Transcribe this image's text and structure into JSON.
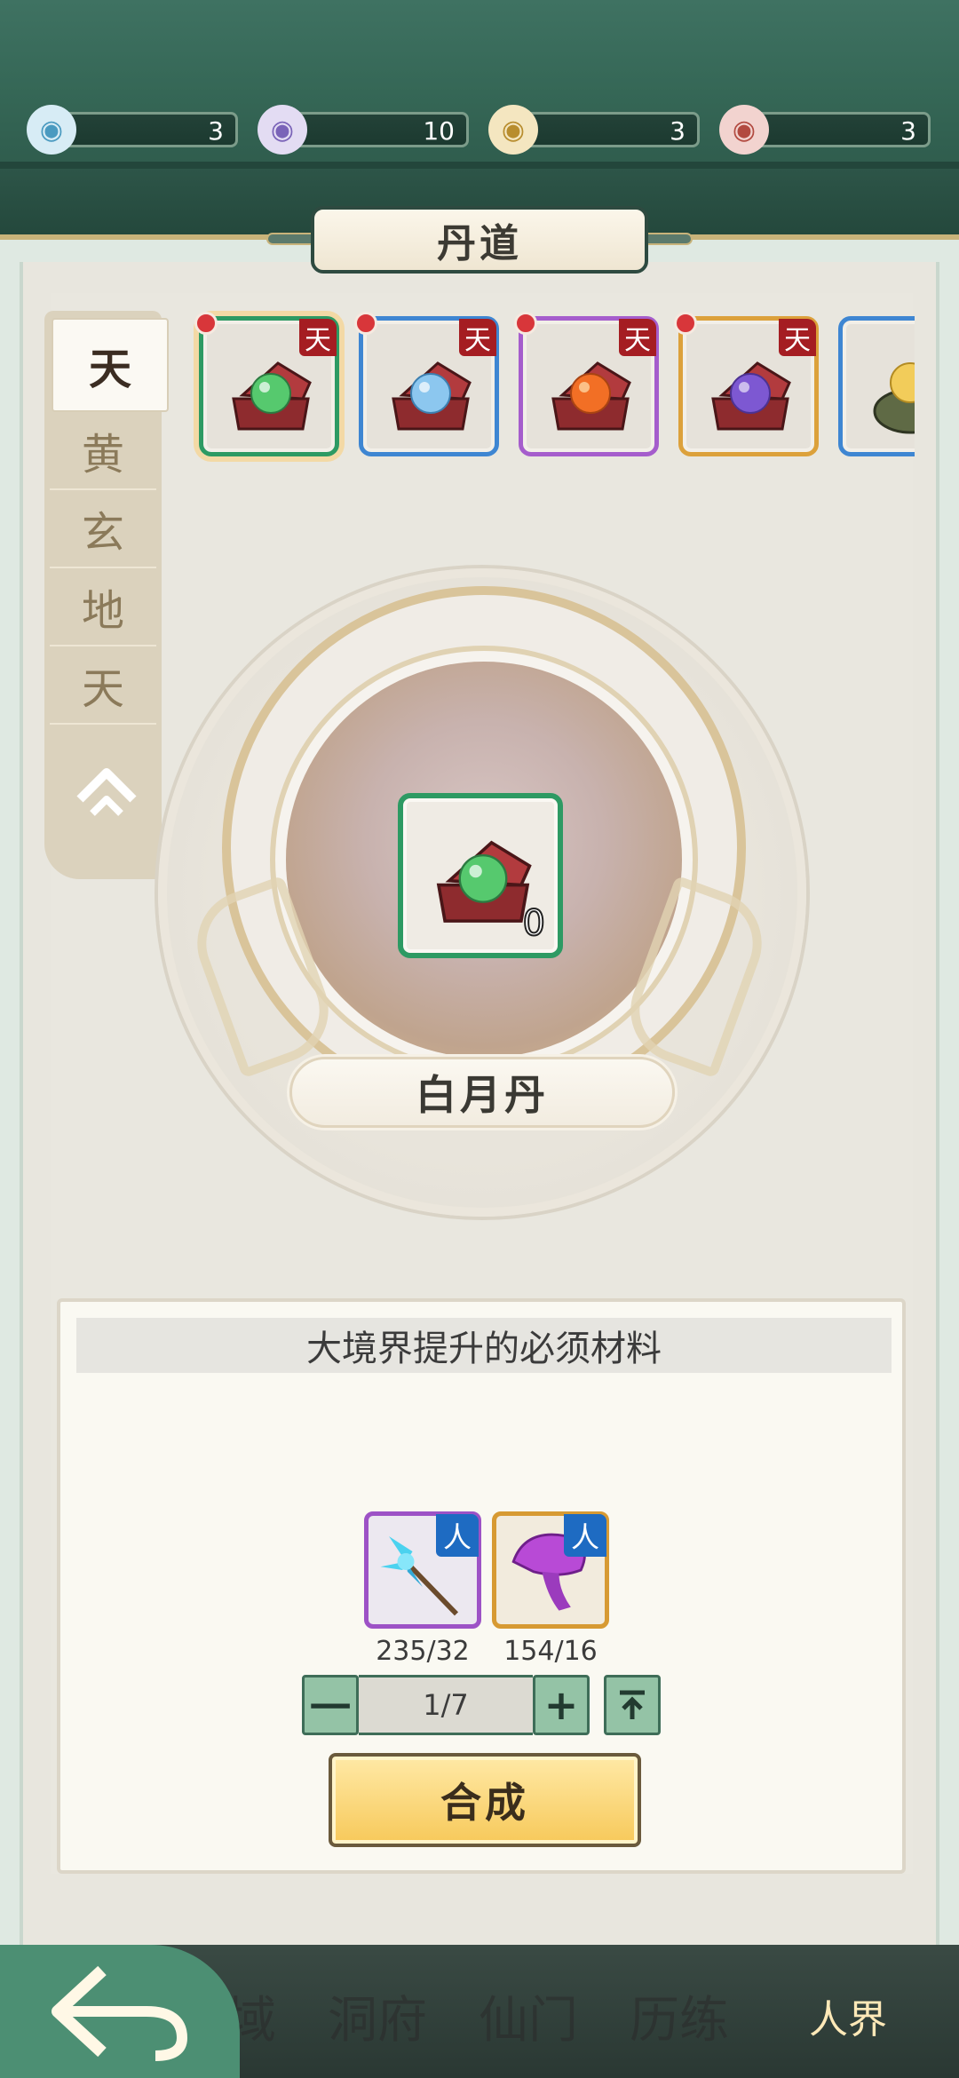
{
  "resources": [
    {
      "icon": "blue-spirit-icon",
      "value": "3",
      "color": "#6ab6d8"
    },
    {
      "icon": "purple-spirit-icon",
      "value": "10",
      "color": "#8e77c8"
    },
    {
      "icon": "gold-spirit-icon",
      "value": "3",
      "color": "#d9b15a"
    },
    {
      "icon": "red-spirit-icon",
      "value": "3",
      "color": "#c8584e"
    }
  ],
  "title": "丹道",
  "tiers": {
    "active": "天",
    "items": [
      "黄",
      "玄",
      "地",
      "天"
    ],
    "collapse_symbol": "^"
  },
  "items": [
    {
      "badge": "天",
      "orb_color": "#56c96e",
      "border": "#2d9a63"
    },
    {
      "badge": "天",
      "orb_color": "#8cc7ef",
      "border": "#3e86d2"
    },
    {
      "badge": "天",
      "orb_color": "#f26f25",
      "border": "#a55dcc"
    },
    {
      "badge": "天",
      "orb_color": "#7d58d2",
      "border": "#dca13b"
    },
    {
      "badge": "",
      "orb_color": "#f2cc5a",
      "border": "#3e86d2"
    }
  ],
  "selected": {
    "name": "白月丹",
    "count": "0"
  },
  "materials": {
    "title": "大境界提升的必须材料",
    "list": [
      {
        "badge": "人",
        "count": "235/32",
        "icon": "blue-flower-icon"
      },
      {
        "badge": "人",
        "count": "154/16",
        "icon": "purple-mushroom-icon"
      }
    ],
    "stepper": {
      "minus": "一",
      "value": "1/7",
      "plus": "+",
      "max": "⤒"
    },
    "combine": "合成"
  },
  "nav": {
    "back": "⟲",
    "items": [
      "界域",
      "洞府",
      "仙门",
      "历练",
      "人界"
    ]
  }
}
